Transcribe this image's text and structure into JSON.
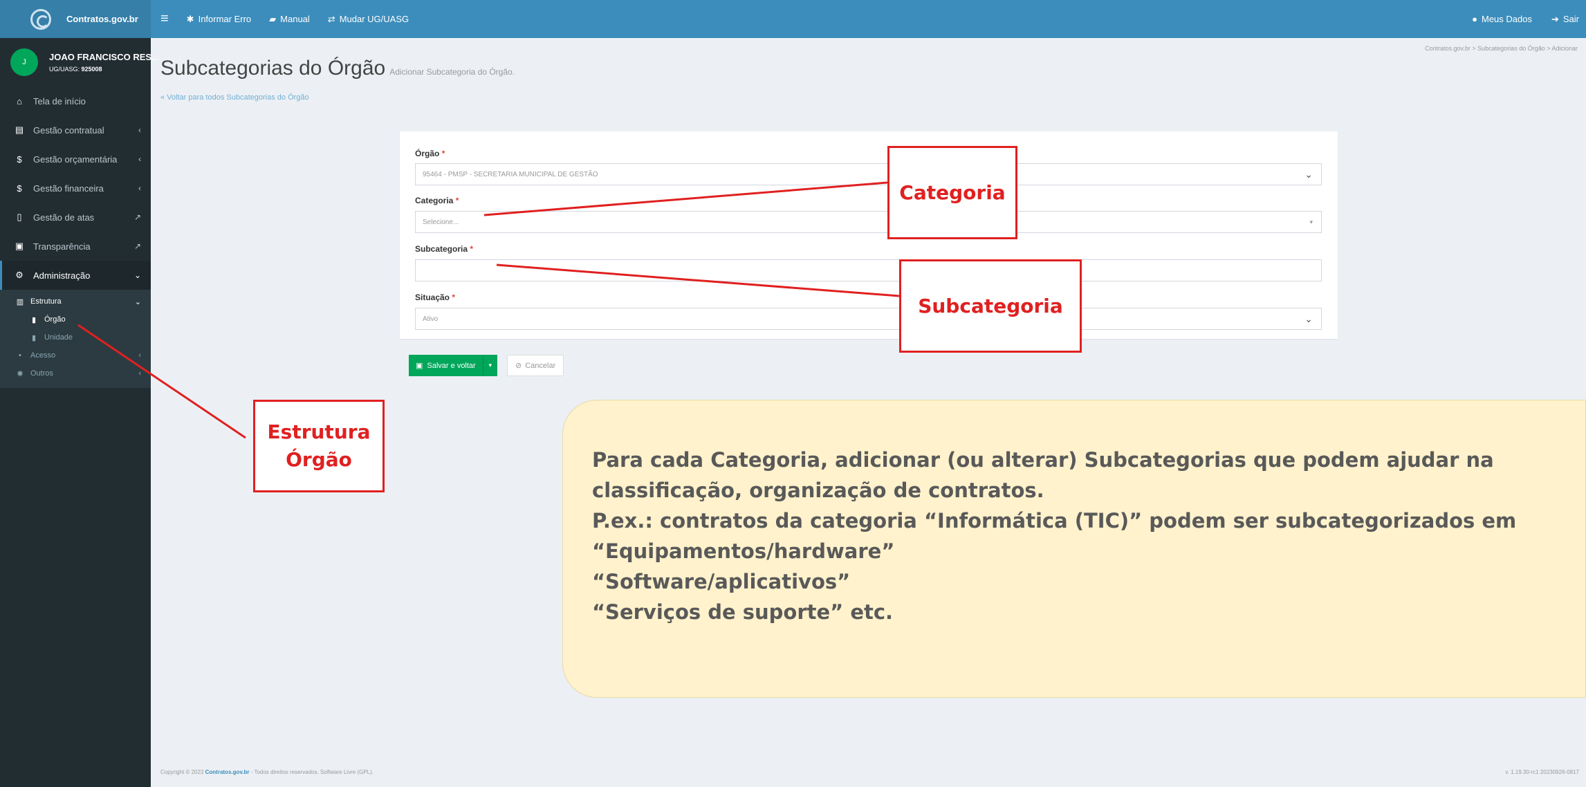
{
  "topbar": {
    "brand": "Contratos.gov.br",
    "nav": [
      {
        "label": "Informar Erro",
        "icon": "bug-icon"
      },
      {
        "label": "Manual",
        "icon": "book-icon"
      },
      {
        "label": "Mudar UG/UASG",
        "icon": "exchange-icon"
      }
    ],
    "right": [
      {
        "label": "Meus Dados",
        "icon": "user-circle-icon"
      },
      {
        "label": "Sair",
        "icon": "sign-out-icon"
      }
    ]
  },
  "sidebar": {
    "user": {
      "initial": "J",
      "name": "JOAO FRANCISCO RES...",
      "ug_label": "UG/UASG:",
      "ug_code": "925008"
    },
    "items": [
      {
        "label": "Tela de início",
        "icon": "home-icon"
      },
      {
        "label": "Gestão contratual",
        "icon": "file-text-icon"
      },
      {
        "label": "Gestão orçamentária",
        "icon": "dollar-icon"
      },
      {
        "label": "Gestão financeira",
        "icon": "dollar-icon"
      },
      {
        "label": "Gestão de atas",
        "icon": "file-icon"
      },
      {
        "label": "Transparência",
        "icon": "id-card-icon"
      },
      {
        "label": "Administração",
        "icon": "cogs-icon"
      }
    ],
    "submenu": {
      "estrutura": "Estrutura",
      "orgao": "Órgão",
      "unidade": "Unidade",
      "acesso": "Acesso",
      "outros": "Outros"
    }
  },
  "page": {
    "title": "Subcategorias do Órgão",
    "subtitle": "Adicionar Subcategoria do Órgão.",
    "breadcrumb": "Contratos.gov.br  >  Subcategorias do Órgão  >  Adicionar",
    "back_link": "« Voltar para todos Subcategorias do Órgão"
  },
  "form": {
    "orgao_label": "Órgão",
    "orgao_value": "95464 - PMSP - SECRETARIA MUNICIPAL DE GESTÃO",
    "categoria_label": "Categoria",
    "categoria_placeholder": "Selecione...",
    "subcategoria_label": "Subcategoria",
    "subcategoria_value": "",
    "situacao_label": "Situação",
    "situacao_value": "Ativo",
    "required_mark": "*"
  },
  "buttons": {
    "save": "Salvar e voltar",
    "cancel": "Cancelar"
  },
  "footer": {
    "prefix": "Copyright © 2023",
    "brand": "Contratos.gov.br",
    "suffix": "- Todos direitos reservados. Software Livre (GPL).",
    "version": "v. 1.19.30-rc1 20230926-0817"
  },
  "annotations": {
    "categoria": "Categoria",
    "subcategoria": "Subcategoria",
    "estrutura_line1": "Estrutura",
    "estrutura_line2": "Órgão",
    "note_lines": [
      "Para cada Categoria, adicionar (ou alterar) Subcategorias que podem ajudar na",
      "classificação, organização de contratos.",
      "P.ex.: contratos da categoria “Informática (TIC)” podem ser subcategorizados em",
      "“Equipamentos/hardware”",
      "“Software/aplicativos”",
      "“Serviços de suporte” etc."
    ],
    "accent_color": "#e02020",
    "note_background": "#fff2cc"
  },
  "colors": {
    "header": "#3c8dbc",
    "sidebar": "#222d32",
    "save_button": "#00a65a"
  }
}
